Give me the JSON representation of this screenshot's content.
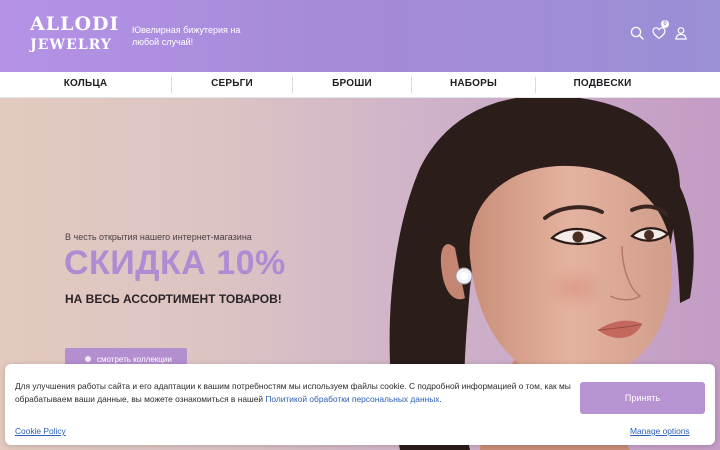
{
  "header": {
    "logo_line1": "ALLODI",
    "logo_line2": "JEWELRY",
    "tagline": "Ювелирная бижутерия на любой случай!",
    "wishlist_count": "0",
    "icons": [
      "search-icon",
      "heart-icon",
      "user-icon"
    ]
  },
  "nav": {
    "items": [
      {
        "label": "КОЛЬЦА"
      },
      {
        "label": "СЕРЬГИ"
      },
      {
        "label": "БРОШИ"
      },
      {
        "label": "НАБОРЫ"
      },
      {
        "label": "ПОДВЕСКИ"
      }
    ]
  },
  "hero": {
    "subtitle": "В честь открытия нашего интернет-магазина",
    "title": "СКИДКА 10%",
    "tagline": "НА ВЕСЬ АССОРТИМЕНТ ТОВАРОВ!",
    "button_label": "смотреть коллекции"
  },
  "cookie": {
    "text": "Для улучшения работы сайта и его адаптации к вашим потребностям мы используем файлы cookie. С подробной информацией о том, как мы обрабатываем ваши данные, вы можете ознакомиться в нашей ",
    "link": "Политикой обработки персональных данных",
    "text_end": ".",
    "accept": "Принять",
    "policy": "Cookie Policy",
    "manage": "Manage options"
  },
  "colors": {
    "header_gradient_start": "#b592e6",
    "header_gradient_end": "#9b8fd6",
    "accent": "#b08ad2",
    "button": "#b793d2",
    "link": "#2b5fb3"
  }
}
